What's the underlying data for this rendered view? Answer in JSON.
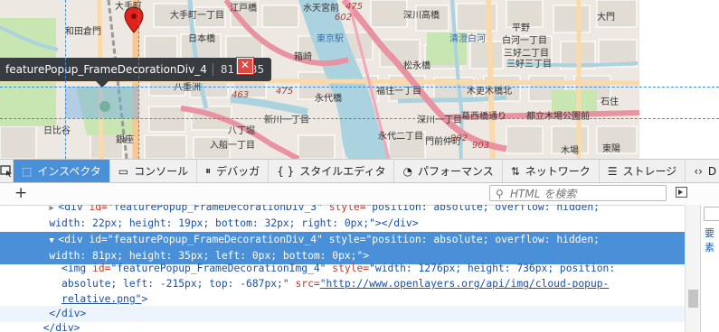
{
  "map": {
    "labels": [
      {
        "text": "大手町",
        "cls": ""
      },
      {
        "text": "大手町一丁目",
        "cls": ""
      },
      {
        "text": "江戸橋",
        "cls": ""
      },
      {
        "text": "水天宮前",
        "cls": ""
      },
      {
        "text": "深川高橋",
        "cls": ""
      },
      {
        "text": "白河一丁目",
        "cls": ""
      },
      {
        "text": "平野",
        "cls": ""
      },
      {
        "text": "大門",
        "cls": ""
      },
      {
        "text": "和田倉門",
        "cls": ""
      },
      {
        "text": "日本橋",
        "cls": ""
      },
      {
        "text": "箱崎",
        "cls": ""
      },
      {
        "text": "清澄白河",
        "cls": "blue"
      },
      {
        "text": "三好二丁目",
        "cls": ""
      },
      {
        "text": "三好三丁目",
        "cls": ""
      },
      {
        "text": "東京駅",
        "cls": "blue"
      },
      {
        "text": "松永橋",
        "cls": ""
      },
      {
        "text": "永代橋",
        "cls": ""
      },
      {
        "text": "福住一丁目",
        "cls": ""
      },
      {
        "text": "木更木橋北",
        "cls": ""
      },
      {
        "text": "八重洲",
        "cls": ""
      },
      {
        "text": "新川一丁目",
        "cls": ""
      },
      {
        "text": "深川一丁目",
        "cls": ""
      },
      {
        "text": "葛西橋通り",
        "cls": ""
      },
      {
        "text": "都立木場公園前",
        "cls": ""
      },
      {
        "text": "木場",
        "cls": ""
      },
      {
        "text": "日比谷",
        "cls": ""
      },
      {
        "text": "銀座",
        "cls": ""
      },
      {
        "text": "八丁堀",
        "cls": ""
      },
      {
        "text": "永代二丁目",
        "cls": ""
      },
      {
        "text": "入船一丁目",
        "cls": ""
      },
      {
        "text": "門前仲町",
        "cls": ""
      },
      {
        "text": "石住",
        "cls": ""
      },
      {
        "text": "東陽",
        "cls": ""
      },
      {
        "text": "602",
        "cls": "red"
      },
      {
        "text": "475",
        "cls": "red"
      },
      {
        "text": "475",
        "cls": "red"
      },
      {
        "text": "463",
        "cls": "red"
      },
      {
        "text": "902",
        "cls": "red"
      },
      {
        "text": "903",
        "cls": "red"
      }
    ],
    "element_tooltip": {
      "name": "featurePopup_FrameDecorationDiv_4",
      "dimensions": "81 × 35"
    },
    "close_glyph": "✕",
    "colors": {
      "water": "#aad3df",
      "park": "#c8e6b2",
      "road_major": "#e892a2",
      "road_trunk": "#f9c792",
      "highlight": "#6eaae6",
      "guide": "#3c8ed8",
      "marker": "#e0231d"
    }
  },
  "toolbar": {
    "tabs": [
      {
        "icon": "⬚",
        "label": "インスペクタ",
        "active": true,
        "name": "tab-inspector",
        "iconName": "inspector-icon"
      },
      {
        "icon": "▭",
        "label": "コンソール",
        "active": false,
        "name": "tab-console",
        "iconName": "console-icon"
      },
      {
        "icon": "⏸",
        "label": "デバッガ",
        "active": false,
        "name": "tab-debugger",
        "iconName": "debugger-icon"
      },
      {
        "icon": "{ }",
        "label": "スタイルエディタ",
        "active": false,
        "name": "tab-style-editor",
        "iconName": "style-editor-icon"
      },
      {
        "icon": "◔",
        "label": "パフォーマンス",
        "active": false,
        "name": "tab-performance",
        "iconName": "performance-icon"
      },
      {
        "icon": "⇅",
        "label": "ネットワーク",
        "active": false,
        "name": "tab-network",
        "iconName": "network-icon"
      },
      {
        "icon": "☰",
        "label": "ストレージ",
        "active": false,
        "name": "tab-storage",
        "iconName": "storage-icon"
      },
      {
        "icon": "‹›",
        "label": "D",
        "active": false,
        "name": "tab-more",
        "iconName": "dom-icon"
      }
    ]
  },
  "search": {
    "add_label": "+",
    "placeholder": "HTML を検索"
  },
  "markup": {
    "line1": {
      "p1": "<div ",
      "a1": "id=",
      "v1": "\"featurePopup_FrameDecorationDiv_3\"",
      "a2": " style=",
      "v2": "\"position: absolute; overflow: hidden;",
      "cont": "width: 22px; height: 19px; bottom: 32px; right: 0px;\"",
      "end": "></div>"
    },
    "line2": {
      "p1": "<div ",
      "a1": "id=",
      "v1": "\"featurePopup_FrameDecorationDiv_4\"",
      "a2": " style=",
      "v2": "\"position: absolute; overflow: hidden;",
      "cont": "width: 81px; height: 35px; left: 0px; bottom: 0px;\"",
      "end": ">"
    },
    "line3": {
      "p1": "<img ",
      "a1": "id=",
      "v1": "\"featurePopup_FrameDecorationImg_4\"",
      "a2": " style=",
      "v2": "\"width: 1276px; height: 736px; position:",
      "cont": "absolute; left: -215px; top: -687px;\"",
      "a3": " src=",
      "link1": "\"http://www.openlayers.org/api/img/cloud-popup-",
      "link2": "relative.png\"",
      "end": ">"
    },
    "close_div1": "</div>",
    "close_div2": "</div>"
  },
  "side_panel": {
    "text": "要素"
  }
}
